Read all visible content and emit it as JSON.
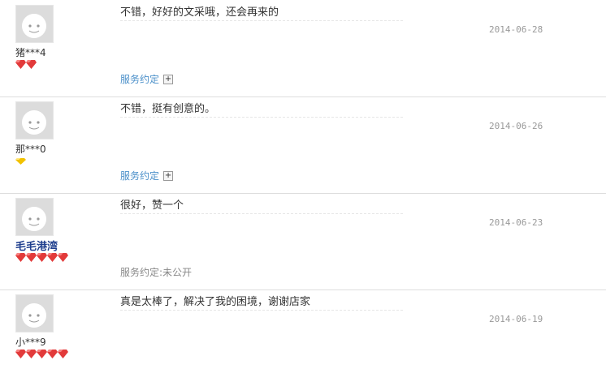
{
  "reviews": [
    {
      "username": "猪***4",
      "comment": "不错，好好的文采哦，还会再来的",
      "date": "2014-06-28",
      "service": "服务约定",
      "service_expand": "+",
      "level_icon": "red-diamond",
      "level_count": 2
    },
    {
      "username": "那***0",
      "comment": "不错，挺有创意的。",
      "date": "2014-06-26",
      "service": "服务约定",
      "service_expand": "+",
      "level_icon": "yellow-diamond",
      "level_count": 1
    },
    {
      "username": "毛毛港湾",
      "comment": "很好，赞一个",
      "date": "2014-06-23",
      "service": "服务约定:未公开",
      "level_icon": "red-diamond",
      "level_count": 5
    },
    {
      "username": "小***9",
      "comment": "真是太棒了，解决了我的困境，谢谢店家",
      "date": "2014-06-19",
      "level_icon": "red-diamond",
      "level_count": 5
    }
  ],
  "colors": {
    "red_diamond": "#e23a3a",
    "yellow_diamond": "#f2c200",
    "link": "#4a8fc9",
    "vip_name": "#1f3f8e"
  }
}
